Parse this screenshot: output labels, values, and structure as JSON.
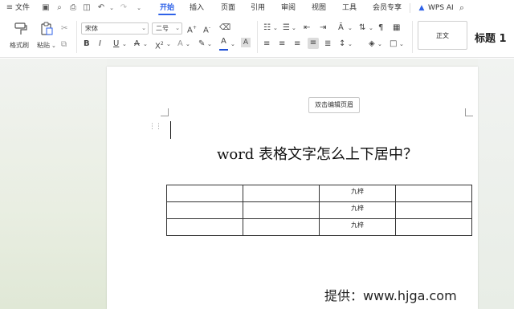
{
  "menubar": {
    "file_label": "文件",
    "tabs": [
      "开始",
      "插入",
      "页面",
      "引用",
      "审阅",
      "视图",
      "工具",
      "会员专享"
    ],
    "active_tab": "开始",
    "wps_ai_label": "WPS AI"
  },
  "ribbon": {
    "format_painter_label": "格式刷",
    "paste_label": "粘贴",
    "font_name": "宋体",
    "font_size": "二号",
    "style_normal": "正文",
    "style_heading1": "标题 1"
  },
  "document": {
    "header_button_label": "双击编辑页眉",
    "title": "word 表格文字怎么上下居中？",
    "table": [
      [
        "",
        "",
        "九梓",
        ""
      ],
      [
        "",
        "",
        "九梓",
        ""
      ],
      [
        "",
        "",
        "九梓",
        ""
      ]
    ]
  },
  "watermark": "提供：www.hjga.com",
  "colors": {
    "accent": "#2f62e8",
    "font_color_bar": "#1f4fd6"
  }
}
